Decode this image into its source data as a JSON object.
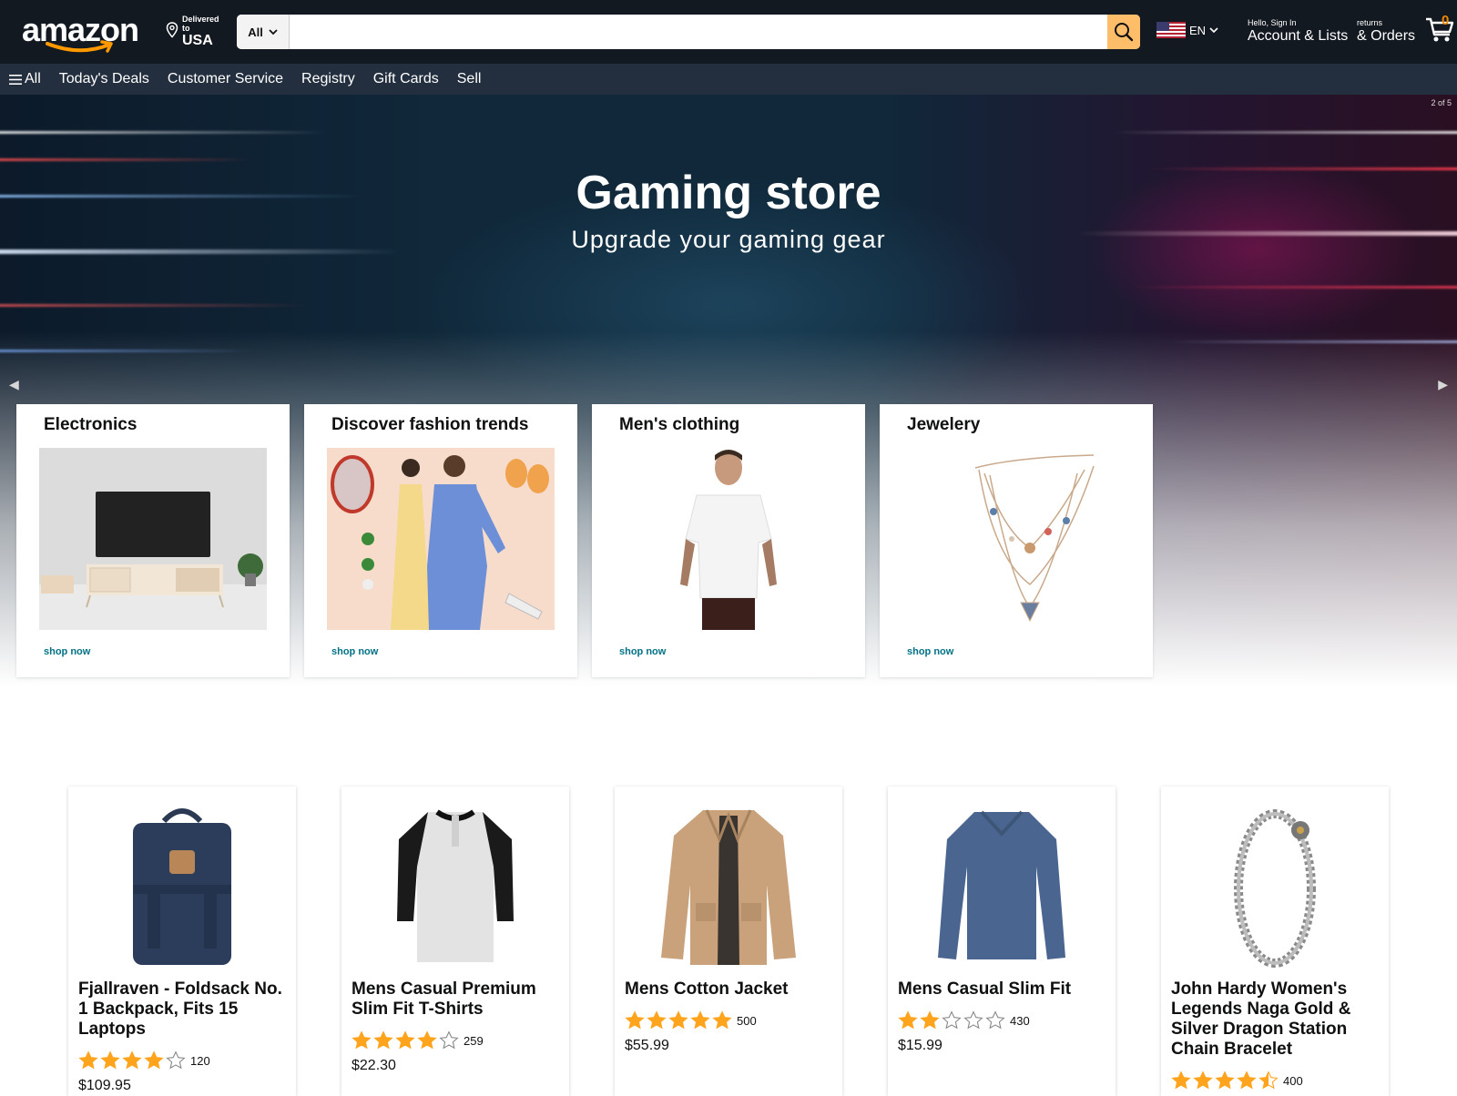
{
  "header": {
    "logo": "amazon",
    "deliver": {
      "line1": "Delivered",
      "line2": "to",
      "country": "USA"
    },
    "search": {
      "category": "All",
      "placeholder": ""
    },
    "language": "EN",
    "account": {
      "small": "Hello, Sign In",
      "big": "Account & Lists"
    },
    "orders": {
      "small": "returns",
      "big": "& Orders"
    },
    "cart_count": "0"
  },
  "nav": {
    "all": "All",
    "items": [
      "Today's Deals",
      "Customer Service",
      "Registry",
      "Gift Cards",
      "Sell"
    ]
  },
  "hero": {
    "title": "Gaming store",
    "subtitle": "Upgrade your gaming gear",
    "counter": "2 of 5"
  },
  "categories": [
    {
      "title": "Electronics",
      "link": "shop now"
    },
    {
      "title": "Discover fashion trends",
      "link": "shop now"
    },
    {
      "title": "Men's clothing",
      "link": "shop now"
    },
    {
      "title": "Jewelery",
      "link": "shop now"
    }
  ],
  "products": [
    {
      "title": "Fjallraven - Foldsack No. 1 Backpack, Fits 15 Laptops",
      "rating": 4,
      "reviews": "120",
      "price": "$109.95"
    },
    {
      "title": "Mens Casual Premium Slim Fit T-Shirts",
      "rating": 4,
      "reviews": "259",
      "price": "$22.30"
    },
    {
      "title": "Mens Cotton Jacket",
      "rating": 5,
      "reviews": "500",
      "price": "$55.99"
    },
    {
      "title": "Mens Casual Slim Fit",
      "rating": 2,
      "reviews": "430",
      "price": "$15.99"
    },
    {
      "title": "John Hardy Women's Legends Naga Gold & Silver Dragon Station Chain Bracelet",
      "rating": 4.5,
      "reviews": "400",
      "price": ""
    }
  ],
  "colors": {
    "header_bg": "#131921",
    "nav_bg": "#232f3e",
    "search_button": "#febd69",
    "star": "#ffa41c",
    "link": "#007185"
  }
}
